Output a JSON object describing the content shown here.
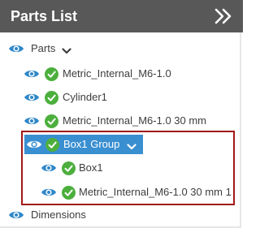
{
  "panel": {
    "title": "Parts List"
  },
  "tree": {
    "parts_label": "Parts",
    "items": [
      {
        "label": "Metric_Internal_M6-1.0"
      },
      {
        "label": "Cylinder1"
      },
      {
        "label": "Metric_Internal_M6-1.0 30 mm"
      },
      {
        "label": "Box1 Group"
      }
    ],
    "group_children": [
      {
        "label": "Box1"
      },
      {
        "label": "Metric_Internal_M6-1.0 30 mm 1"
      }
    ],
    "dimensions_label": "Dimensions"
  },
  "colors": {
    "header_bg": "#585858",
    "eye_icon": "#2f87c9",
    "check_icon": "#4caf3d",
    "selected_bg": "#3a8fd1",
    "highlight_border": "#a01a1a"
  }
}
